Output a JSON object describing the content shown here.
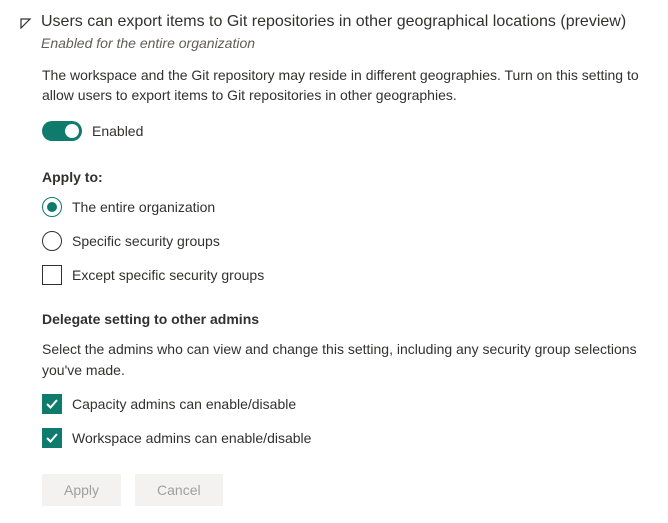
{
  "header": {
    "title": "Users can export items to Git repositories in other geographical locations (preview)",
    "subtitle": "Enabled for the entire organization"
  },
  "description": "The workspace and the Git repository may reside in different geographies. Turn on this setting to allow users to export items to Git repositories in other geographies.",
  "toggle": {
    "label": "Enabled"
  },
  "apply": {
    "heading": "Apply to:",
    "options": {
      "entire": "The entire organization",
      "specific": "Specific security groups"
    },
    "except": "Except specific security groups"
  },
  "delegate": {
    "heading": "Delegate setting to other admins",
    "description": "Select the admins who can view and change this setting, including any security group selections you've made.",
    "capacity": "Capacity admins can enable/disable",
    "workspace": "Workspace admins can enable/disable"
  },
  "buttons": {
    "apply": "Apply",
    "cancel": "Cancel"
  }
}
